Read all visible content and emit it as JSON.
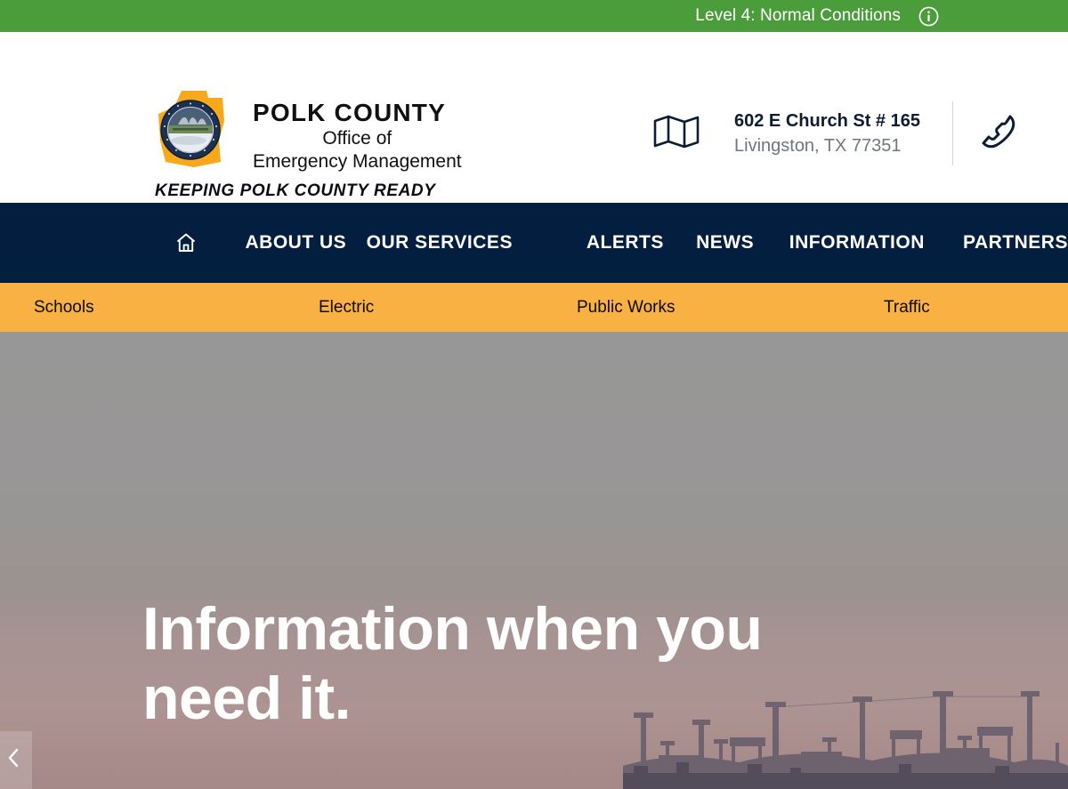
{
  "status_bar": {
    "text": "Level 4: Normal Conditions",
    "icon": "info-circle-icon",
    "bg_color": "#4b9c3a",
    "text_color": "#ffffff"
  },
  "header": {
    "logo": {
      "icon": "polk-county-seal-icon",
      "shape_color": "#f7a81b",
      "seal_color": "#1c3050"
    },
    "org_name_line1": "POLK COUNTY",
    "org_name_line2": "Office of",
    "org_name_line3": "Emergency Management",
    "tagline": "KEEPING POLK COUNTY READY",
    "contact": {
      "map_icon": "map-icon",
      "address_line1": "602 E Church St # 165",
      "address_line2": "Livingston, TX 77351",
      "phone_icon": "phone-icon"
    }
  },
  "main_nav": {
    "bg_color": "#031e3f",
    "home_icon": "home-icon",
    "items": [
      {
        "label": "ABOUT US"
      },
      {
        "label": "OUR SERVICES"
      },
      {
        "label": "ALERTS"
      },
      {
        "label": "NEWS"
      },
      {
        "label": "INFORMATION"
      },
      {
        "label": "PARTNERS"
      }
    ]
  },
  "sub_nav": {
    "bg_color": "#f9b143",
    "items": [
      {
        "label": "Schools"
      },
      {
        "label": "Electric"
      },
      {
        "label": "Public Works"
      },
      {
        "label": "Traffic"
      }
    ]
  },
  "hero": {
    "headline": "Information when you need it.",
    "prev_icon": "chevron-left-icon"
  }
}
